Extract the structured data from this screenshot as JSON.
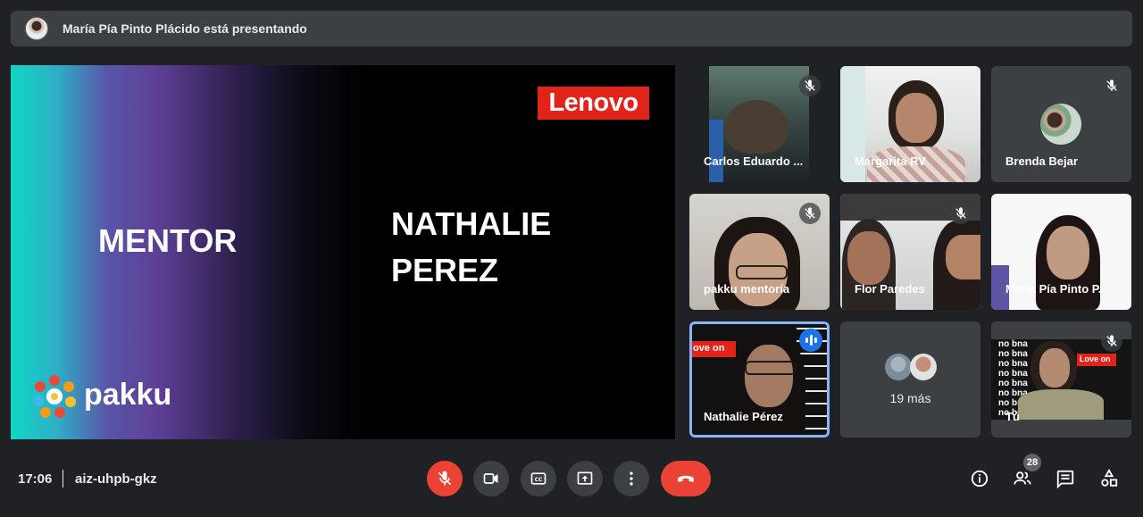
{
  "banner": {
    "presenting_text": "María Pía Pinto Plácido está presentando"
  },
  "slide": {
    "left_heading": "MENTOR",
    "name_line1": "NATHALIE",
    "name_line2": "PEREZ",
    "brand_logo": "Lenovo",
    "org_logo": "pakku"
  },
  "tiles": [
    {
      "name": "Carlos Eduardo ...",
      "muted": true
    },
    {
      "name": "Margarita RV",
      "muted": false
    },
    {
      "name": "Brenda Bejar",
      "muted": true
    },
    {
      "name": "pakku mentoría",
      "muted": true
    },
    {
      "name": "Flor Paredes",
      "muted": true
    },
    {
      "name": "María Pía Pinto P...",
      "muted": false
    },
    {
      "name": "Nathalie Pérez",
      "muted": false,
      "speaking": true,
      "overlay_text": "ove on"
    },
    {
      "name": "19 más",
      "muted": false
    },
    {
      "name": "Tú",
      "muted": true,
      "overlay_text": "Love on",
      "wall_text": "no bna"
    }
  ],
  "bottom_bar": {
    "time": "17:06",
    "meeting_code": "aiz-uhpb-gkz",
    "participant_count": "28",
    "controls": [
      "mic-off-icon",
      "camera-icon",
      "captions-icon",
      "present-icon",
      "more-vert-icon",
      "hangup-icon"
    ],
    "right_icons": [
      "info-icon",
      "people-icon",
      "chat-icon",
      "activities-icon"
    ]
  },
  "colors": {
    "background": "#202124",
    "tile": "#3c4043",
    "danger": "#ea4335",
    "active": "#8ab4f8",
    "speaking": "#1a73e8",
    "lenovo_red": "#e2231a"
  }
}
